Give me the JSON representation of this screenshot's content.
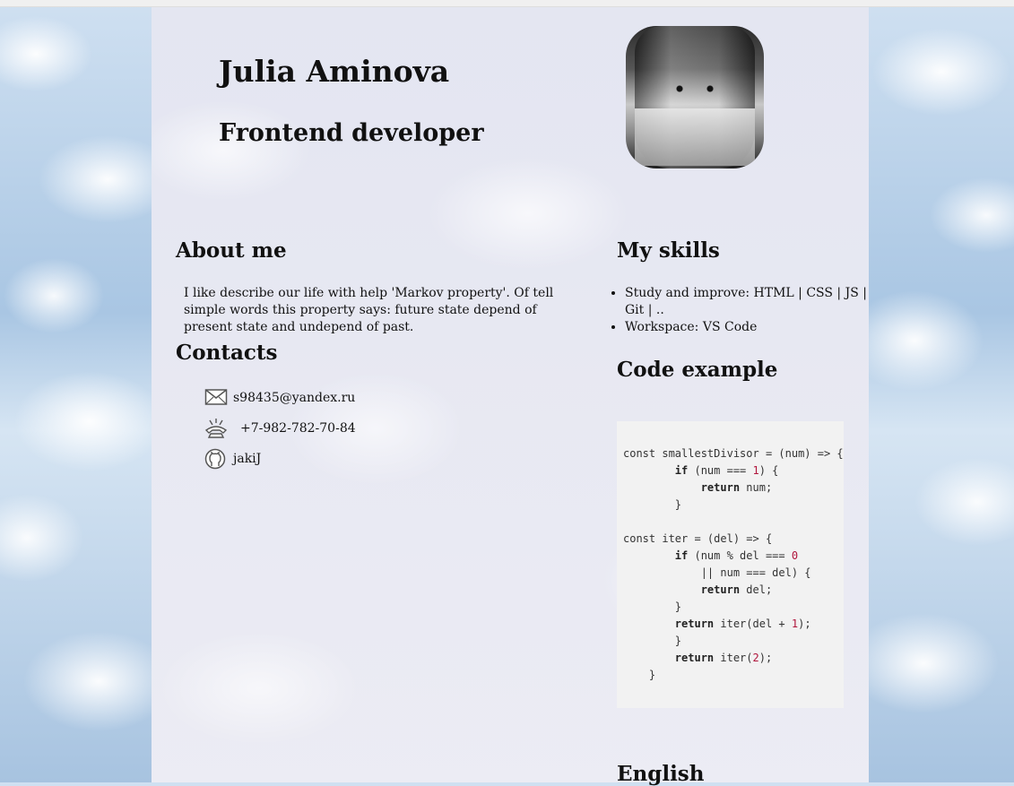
{
  "header": {
    "name": "Julia Aminova",
    "role": "Frontend developer",
    "photo_icon": "portrait-photo-icon"
  },
  "about": {
    "heading": "About me",
    "text": "I like describe our life with help 'Markov property'. Of tell simple words this property says: future state depend of present state and undepend of past."
  },
  "contacts": {
    "heading": "Contacts",
    "items": [
      {
        "icon": "mail-icon",
        "value": "s98435@yandex.ru"
      },
      {
        "icon": "phone-icon",
        "value": "+7-982-782-70-84"
      },
      {
        "icon": "github-icon",
        "value": "jakiJ"
      }
    ]
  },
  "skills": {
    "heading": "My skills",
    "items": [
      "Study and improve: HTML | CSS | JS | Git | ..",
      "Workspace: VS Code"
    ]
  },
  "code_example": {
    "heading": "Code example",
    "lines": [
      "const smallestDivisor = (num) => {",
      "        if (num === 1) {",
      "            return num;",
      "        }",
      "",
      "const iter = (del) => {",
      "        if (num % del === 0",
      "            || num === del) {",
      "            return del;",
      "        }",
      "        return iter(del + 1);",
      "        }",
      "        return iter(2);",
      "    }"
    ]
  },
  "english": {
    "heading": "English"
  }
}
